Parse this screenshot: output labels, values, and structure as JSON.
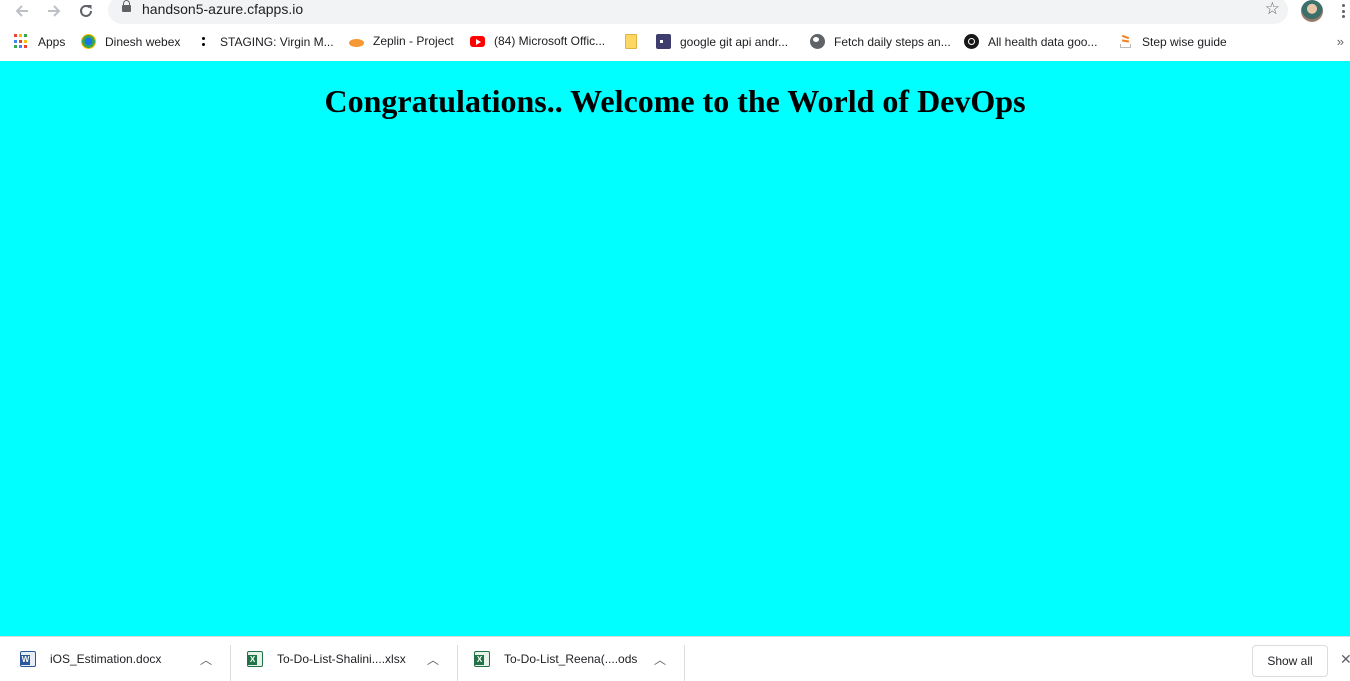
{
  "browser": {
    "url": "handson5-azure.cfapps.io",
    "icons": {
      "back": "arrow-left-icon",
      "forward": "arrow-right-icon",
      "reload": "reload-icon",
      "lock": "lock-icon",
      "star": "star-icon",
      "menu": "kebab-menu-icon"
    }
  },
  "bookmarks": [
    {
      "label": "Apps",
      "icon": "apps-grid-icon"
    },
    {
      "label": "Dinesh webex",
      "icon": "webex-icon"
    },
    {
      "label": "STAGING: Virgin M...",
      "icon": "virgin-icon"
    },
    {
      "label": "Zeplin - Project",
      "icon": "zeplin-icon"
    },
    {
      "label": "(84) Microsoft Offic...",
      "icon": "youtube-icon"
    },
    {
      "label": "",
      "icon": "folder-icon"
    },
    {
      "label": "google git api andr...",
      "icon": "terminal-icon"
    },
    {
      "label": "Fetch daily steps an...",
      "icon": "globe-icon"
    },
    {
      "label": "All health data goo...",
      "icon": "github-icon"
    },
    {
      "label": "Step wise guide",
      "icon": "stackoverflow-icon"
    }
  ],
  "page": {
    "headline": "Congratulations.. Welcome to the World of DevOps",
    "background": "#00ffff"
  },
  "downloads": {
    "items": [
      {
        "name": "iOS_Estimation.docx",
        "type": "word"
      },
      {
        "name": "To-Do-List-Shalini....xlsx",
        "type": "excel"
      },
      {
        "name": "To-Do-List_Reena(....ods",
        "type": "excel"
      }
    ],
    "show_all": "Show all"
  },
  "colors": {
    "page_background": "#00ffff",
    "word_blue": "#2b579a",
    "excel_green": "#217346"
  }
}
